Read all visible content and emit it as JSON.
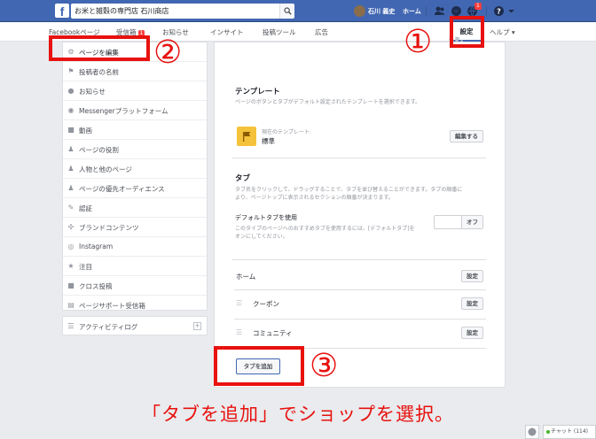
{
  "topbar": {
    "search_value": "お米と雑穀の専門店 石川商店",
    "profile_name": "石川 義史",
    "home_label": "ホーム",
    "notif_count": "1"
  },
  "page_nav": {
    "items": [
      {
        "label": "Facebookページ"
      },
      {
        "label": "受信箱",
        "badge": "1"
      },
      {
        "label": "お知らせ"
      },
      {
        "label": "インサイト"
      },
      {
        "label": "投稿ツール"
      },
      {
        "label": "広告"
      }
    ],
    "settings_label": "設定",
    "help_label": "ヘルプ ▾"
  },
  "sidebar": {
    "items": [
      {
        "label": "ページを編集",
        "icon": "gear-icon"
      },
      {
        "label": "投稿者の名前",
        "icon": "flag-icon"
      },
      {
        "label": "お知らせ",
        "icon": "globe-icon"
      },
      {
        "label": "Messengerプラットフォーム",
        "icon": "messenger-icon"
      },
      {
        "label": "動画",
        "icon": "video-icon"
      },
      {
        "label": "ページの役割",
        "icon": "person-icon"
      },
      {
        "label": "人物と他のページ",
        "icon": "people-icon"
      },
      {
        "label": "ページの優先オーディエンス",
        "icon": "audience-icon"
      },
      {
        "label": "認証",
        "icon": "wrench-icon"
      },
      {
        "label": "ブランドコンテンツ",
        "icon": "handshake-icon"
      },
      {
        "label": "Instagram",
        "icon": "instagram-icon"
      },
      {
        "label": "注目",
        "icon": "star-icon"
      },
      {
        "label": "クロス投稿",
        "icon": "video-icon"
      },
      {
        "label": "ページサポート受信箱",
        "icon": "inbox-icon"
      }
    ],
    "activity_label": "アクティビティログ"
  },
  "main": {
    "template_heading": "テンプレート",
    "template_desc": "ページのボタンとタブがデフォルト設定されたテンプレートを選択できます。",
    "current_template_label": "現在のテンプレート:",
    "current_template_value": "標準",
    "edit_button": "編集する",
    "tabs_heading": "タブ",
    "tabs_desc_1": "タブ名をクリックして、ドラッグすることで、タブを並び替えることができます。タブの順番に",
    "tabs_desc_2": "より、ページトップに表示されるセクションの順番が決まります。",
    "default_tab_label": "デフォルトタブを使用",
    "default_tab_desc_1": "このタイプのページへのおすすめタブを使用するには、[デフォルトタブ]を",
    "default_tab_desc_2": "オンにしてください。",
    "toggle_off": "オフ",
    "tabs": [
      {
        "label": "ホーム",
        "button": "設定"
      },
      {
        "label": "クーポン",
        "button": "設定"
      },
      {
        "label": "コミュニティ",
        "button": "設定"
      }
    ],
    "add_tab_button": "タブを追加"
  },
  "annotations": {
    "num1": "①",
    "num2": "②",
    "num3": "③",
    "caption": "「タブを追加」でショップを選択。",
    "color": "#e8110e"
  },
  "chat": {
    "label": "チャット (114)"
  }
}
